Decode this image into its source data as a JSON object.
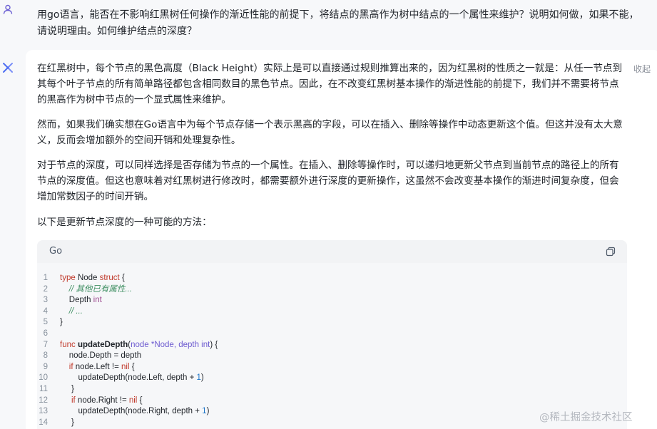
{
  "user_message": {
    "text": "用go语言，能否在不影响红黑树任何操作的渐近性能的前提下，将结点的黑高作为树中结点的一个属性来维护？说明如何做，如果不能，请说明理由。如何维护结点的深度？"
  },
  "assistant_message": {
    "collapse_label": "收起",
    "paragraphs": [
      "在红黑树中，每个节点的黑色高度（Black Height）实际上是可以直接通过规则推算出来的，因为红黑树的性质之一就是：从任一节点到其每个叶子节点的所有简单路径都包含相同数目的黑色节点。因此，在不改变红黑树基本操作的渐进性能的前提下，我们并不需要将节点的黑高作为树中节点的一个显式属性来维护。",
      "然而，如果我们确实想在Go语言中为每个节点存储一个表示黑高的字段，可以在插入、删除等操作中动态更新这个值。但这并没有太大意义，反而会增加额外的空间开销和处理复杂性。",
      "对于节点的深度，可以同样选择是否存储为节点的一个属性。在插入、删除等操作时，可以递归地更新父节点到当前节点的路径上的所有节点的深度值。但这也意味着对红黑树进行修改时，都需要额外进行深度的更新操作，这虽然不会改变基本操作的渐进时间复杂度，但会增加常数因子的时间开销。",
      "以下是更新节点深度的一种可能的方法："
    ],
    "code_block": {
      "language": "Go",
      "copy_icon": "copy-icon",
      "lines": [
        {
          "n": "1",
          "tokens": [
            {
              "t": "type",
              "c": "kw"
            },
            {
              "t": " Node ",
              "c": ""
            },
            {
              "t": "struct",
              "c": "kw"
            },
            {
              "t": " {",
              "c": ""
            }
          ]
        },
        {
          "n": "2",
          "tokens": [
            {
              "t": "    ",
              "c": ""
            },
            {
              "t": "// 其他已有属性...",
              "c": "cm"
            }
          ]
        },
        {
          "n": "3",
          "tokens": [
            {
              "t": "    Depth ",
              "c": ""
            },
            {
              "t": "int",
              "c": "ty"
            }
          ]
        },
        {
          "n": "4",
          "tokens": [
            {
              "t": "    ",
              "c": ""
            },
            {
              "t": "// ...",
              "c": "cm"
            }
          ]
        },
        {
          "n": "5",
          "tokens": [
            {
              "t": "}",
              "c": ""
            }
          ]
        },
        {
          "n": "6",
          "tokens": []
        },
        {
          "n": "7",
          "tokens": [
            {
              "t": "func",
              "c": "kw"
            },
            {
              "t": " ",
              "c": ""
            },
            {
              "t": "updateDepth",
              "c": "fn"
            },
            {
              "t": "(",
              "c": ""
            },
            {
              "t": "node *Node, depth int",
              "c": "pa"
            },
            {
              "t": ") {",
              "c": ""
            }
          ]
        },
        {
          "n": "8",
          "tokens": [
            {
              "t": "    node.Depth = depth",
              "c": ""
            }
          ]
        },
        {
          "n": "9",
          "tokens": [
            {
              "t": "    ",
              "c": ""
            },
            {
              "t": "if",
              "c": "kw"
            },
            {
              "t": " node.Left != ",
              "c": ""
            },
            {
              "t": "nil",
              "c": "kw"
            },
            {
              "t": " {",
              "c": ""
            }
          ]
        },
        {
          "n": "10",
          "tokens": [
            {
              "t": "        updateDepth(node.Left, depth + ",
              "c": ""
            },
            {
              "t": "1",
              "c": "nu"
            },
            {
              "t": ")",
              "c": ""
            }
          ]
        },
        {
          "n": "11",
          "tokens": [
            {
              "t": "     }",
              "c": ""
            }
          ]
        },
        {
          "n": "12",
          "tokens": [
            {
              "t": "     ",
              "c": ""
            },
            {
              "t": "if",
              "c": "kw"
            },
            {
              "t": " node.Right != ",
              "c": ""
            },
            {
              "t": "nil",
              "c": "kw"
            },
            {
              "t": " {",
              "c": ""
            }
          ]
        },
        {
          "n": "13",
          "tokens": [
            {
              "t": "        updateDepth(node.Right, depth + ",
              "c": ""
            },
            {
              "t": "1",
              "c": "nu"
            },
            {
              "t": ")",
              "c": ""
            }
          ]
        },
        {
          "n": "14",
          "tokens": [
            {
              "t": "     }",
              "c": ""
            }
          ]
        }
      ]
    }
  },
  "watermark": "@稀土掘金技术社区",
  "colors": {
    "accent": "#4e6ef2",
    "keyword": "#c0392b",
    "comment": "#3d8e61"
  }
}
